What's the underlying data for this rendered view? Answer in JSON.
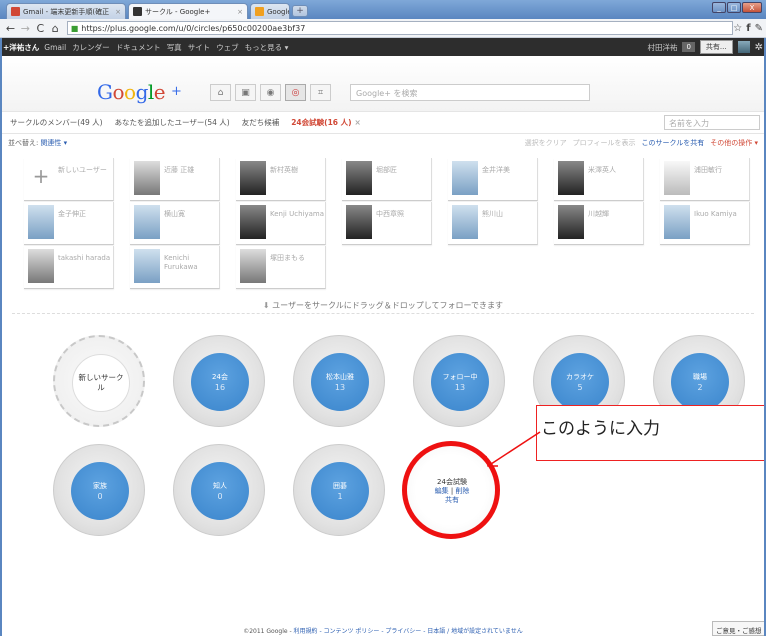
{
  "browser": {
    "tabs": [
      {
        "label": "Gmail - 端末更新手順(確正",
        "icon_color": "#d14836"
      },
      {
        "label": "サークル - Google+",
        "icon_color": "#333333"
      },
      {
        "label": "Google+(グーグルプラス)へごけ",
        "icon_color": "#f0a020"
      }
    ],
    "new_tab": "+",
    "url": "https://plus.google.com/u/0/circles/p650c00200ae3bf37",
    "win_min": "_",
    "win_max": "□",
    "win_close": "X"
  },
  "gbar": {
    "me": "+洋祐さん",
    "links": [
      "Gmail",
      "カレンダー",
      "ドキュメント",
      "写真",
      "サイト",
      "ウェブ",
      "もっと見る ▾"
    ],
    "user_name": "村田洋祐",
    "notifications": "0",
    "share": "共有..."
  },
  "header": {
    "logo": "Google",
    "logo_plus": "+",
    "search_placeholder": "Google+ を検索"
  },
  "circle_tabs": {
    "items": [
      "サークルのメンバー(49 人)",
      "あなたを追加したユーザー(54 人)",
      "友だち候補"
    ],
    "active": "24会試験(16 人)",
    "close": "×",
    "name_placeholder": "名前を入力"
  },
  "sort": {
    "label": "並べ替え:",
    "value": "関連性 ▾",
    "actions": [
      "選択をクリア",
      "プロフィールを表示"
    ],
    "share_circle": "このサークルを共有",
    "more": "その他の操作 ▾"
  },
  "people": [
    {
      "name": "新しいユーザー",
      "kind": "add"
    },
    {
      "name": "近藤 正雄",
      "photo": "g"
    },
    {
      "name": "新村英樹",
      "photo": "d"
    },
    {
      "name": "堀部匠",
      "photo": "d"
    },
    {
      "name": "金井洋美",
      "photo": "b"
    },
    {
      "name": "米澤英人",
      "photo": "d"
    },
    {
      "name": "浦田敏行",
      "photo": "w"
    },
    {
      "name": "金子伸正",
      "photo": "b"
    },
    {
      "name": "横山寛",
      "photo": "b"
    },
    {
      "name": "Kenji Uchiyama",
      "photo": "d",
      "dark_tail": "ma"
    },
    {
      "name": "中西章照",
      "photo": "d"
    },
    {
      "name": "熊川山",
      "photo": "b"
    },
    {
      "name": "川越輝",
      "photo": "d"
    },
    {
      "name": "Ikuo Kamiya",
      "photo": "b"
    },
    {
      "name": "takashi harada",
      "photo": "g"
    },
    {
      "name": "Kenichi Furukawa",
      "photo": "b",
      "dark_tail": "Furukawa"
    },
    {
      "name": "塚田まもる",
      "photo": "g"
    }
  ],
  "hint": {
    "arrow": "⬇",
    "text": "ユーザーをサークルにドラッグ＆ドロップしてフォローできます"
  },
  "circles": [
    {
      "name": "新しいサーク\nル",
      "count": "",
      "kind": "new"
    },
    {
      "name": "24会",
      "count": "16"
    },
    {
      "name": "松本山雅",
      "count": "13"
    },
    {
      "name": "フォロー中",
      "count": "13"
    },
    {
      "name": "カラオケ",
      "count": "5"
    },
    {
      "name": "職場",
      "count": "2"
    },
    {
      "name": "家族",
      "count": "0"
    },
    {
      "name": "知人",
      "count": "0"
    },
    {
      "name": "囲碁",
      "count": "1"
    }
  ],
  "edit_circle": {
    "name": "24会試験",
    "edit": "編集",
    "sep": " | ",
    "delete": "削除",
    "share": "共有"
  },
  "annotation": {
    "text": "このように入力",
    "color": "#ee1111"
  },
  "footer": {
    "copyright": "©2011 Google - ",
    "terms": "利用規約 - コンテンツ ポリシー - プライバシー - 日本語 / 地域が設定されていません",
    "feedback": "ご意見・ご感想"
  }
}
